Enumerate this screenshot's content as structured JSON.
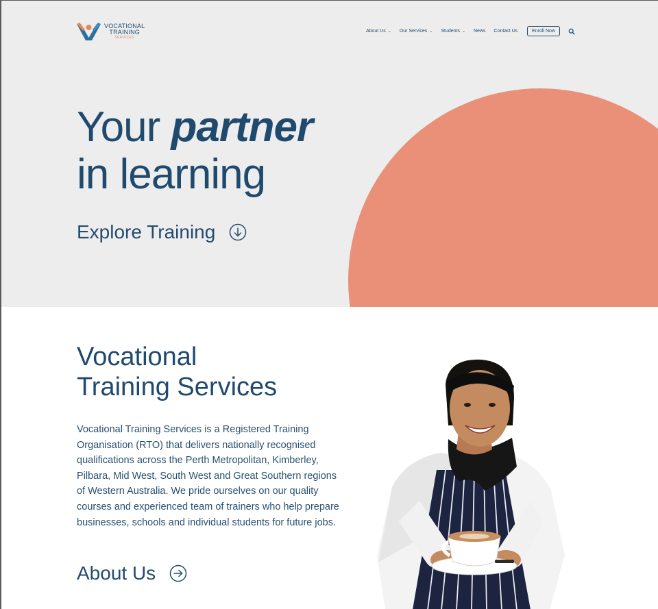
{
  "header": {
    "logo": {
      "line1": "VOCATIONAL",
      "line2": "TRAINING",
      "line3": "SERVICES"
    },
    "nav": [
      {
        "label": "About Us",
        "has_dropdown": true
      },
      {
        "label": "Our Services",
        "has_dropdown": true
      },
      {
        "label": "Students",
        "has_dropdown": true
      },
      {
        "label": "News",
        "has_dropdown": false
      },
      {
        "label": "Contact Us",
        "has_dropdown": false
      }
    ],
    "enroll_label": "Enroll Now",
    "search_icon": "search-icon"
  },
  "hero": {
    "title_part1": "Your",
    "title_em": "partner",
    "title_line2": "in learning",
    "cta_label": "Explore Training",
    "cta_icon": "arrow-down-circle-icon"
  },
  "about": {
    "heading_line1": "Vocational",
    "heading_line2": "Training Services",
    "body": "Vocational Training Services is a Registered Training Organisation (RTO) that delivers nationally recognised qualifications across the Perth Metropolitan, Kimberley, Pilbara, Mid West, South West and Great Southern regions of Western Australia. We pride ourselves on our quality courses and experienced team of trainers who help prepare businesses, schools and individual students for future jobs.",
    "link_label": "About Us",
    "link_icon": "arrow-right-circle-icon"
  },
  "colors": {
    "brand_navy": "#1f4a6e",
    "accent_coral": "#ea9079",
    "hero_bg": "#ededed"
  }
}
